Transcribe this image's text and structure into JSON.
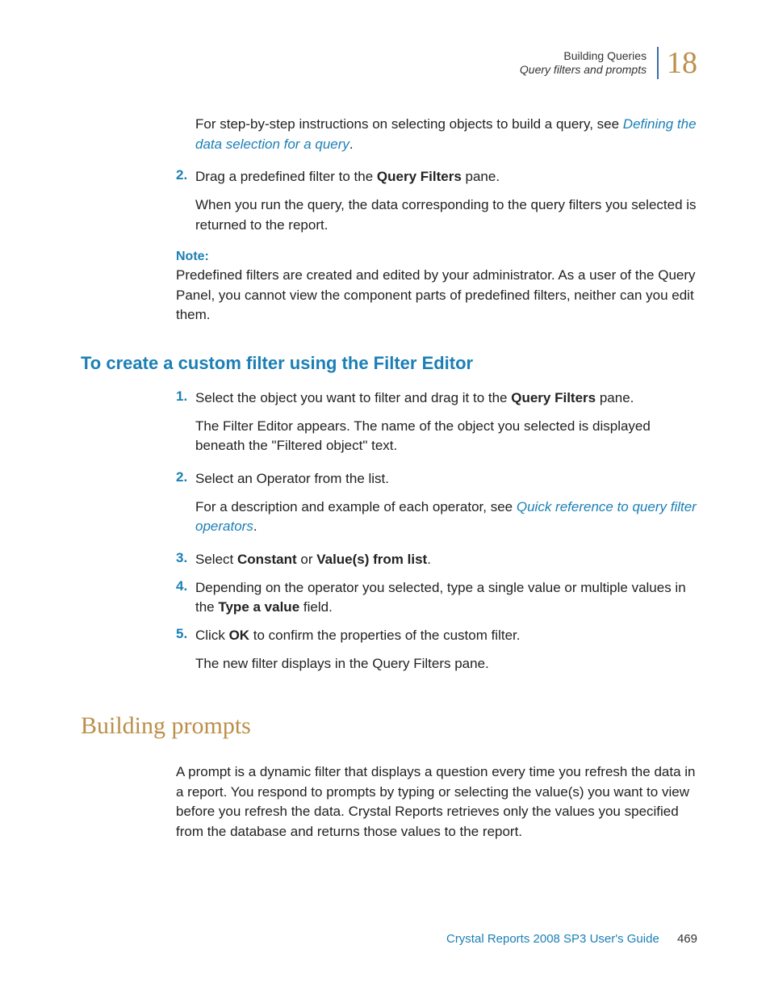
{
  "header": {
    "line1": "Building Queries",
    "line2": "Query filters and prompts",
    "chapter_number": "18"
  },
  "body": {
    "intro1_a": "For step-by-step instructions on selecting objects to build a query, see ",
    "intro1_link": "Defining the data selection for a query",
    "intro1_b": ".",
    "step2_num": "2.",
    "step2_a": "Drag a predefined filter to the ",
    "step2_bold": "Query Filters",
    "step2_b": " pane.",
    "step2_p": "When you run the query, the data corresponding to the query filters you selected is returned to the report.",
    "note_label": "Note:",
    "note_p": "Predefined filters are created and edited by your administrator. As a user of the Query Panel, you cannot view the component parts of predefined filters, neither can you edit them.",
    "h3": "To create a custom filter using the Filter Editor",
    "s1_num": "1.",
    "s1_a": "Select the object you want to filter and drag it to the ",
    "s1_bold": "Query Filters",
    "s1_b": " pane.",
    "s1_p": "The Filter Editor appears. The name of the object you selected is displayed beneath the \"Filtered object\" text.",
    "s2_num": "2.",
    "s2_a": "Select an Operator from the list.",
    "s2_p_a": "For a description and example of each operator, see ",
    "s2_p_link": "Quick reference to query filter operators",
    "s2_p_b": ".",
    "s3_num": "3.",
    "s3_a": "Select ",
    "s3_b1": "Constant",
    "s3_b": " or ",
    "s3_b2": "Value(s) from list",
    "s3_c": ".",
    "s4_num": "4.",
    "s4_a": "Depending on the operator you selected, type a single value or multiple values in the ",
    "s4_bold": "Type a value",
    "s4_b": " field.",
    "s5_num": "5.",
    "s5_a": "Click ",
    "s5_bold": "OK",
    "s5_b": " to confirm the properties of the custom filter.",
    "s5_p": "The new filter displays in the Query Filters pane.",
    "h2": "Building prompts",
    "prompts_p": "A prompt is a dynamic filter that displays a question every time you refresh the data in a report. You respond to prompts by typing or selecting the value(s) you want to view before you refresh the data. Crystal Reports retrieves only the values you specified from the database and returns those values to the report."
  },
  "footer": {
    "guide": "Crystal Reports 2008 SP3 User's Guide",
    "page": "469"
  }
}
